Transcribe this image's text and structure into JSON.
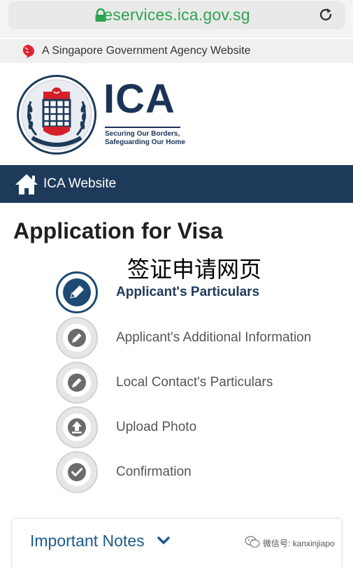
{
  "browser": {
    "url": "eservices.ica.gov.sg"
  },
  "gov_banner": {
    "text": "A Singapore Government Agency Website"
  },
  "logo": {
    "title": "ICA",
    "tagline_line1": "Securing Our Borders,",
    "tagline_line2": "Safeguarding Our Home",
    "crest_ring_text": "IMMIGRATION & CHECKPOINTS AUTHORITY SINGAPORE"
  },
  "nav": {
    "home_label": "ICA Website"
  },
  "page": {
    "title": "Application for Visa",
    "subtitle": "签证申请网页"
  },
  "steps": [
    {
      "label": "Applicant's Particulars",
      "state": "active",
      "icon": "pencil-icon"
    },
    {
      "label": "Applicant's Additional Information",
      "state": "inactive",
      "icon": "pencil-icon"
    },
    {
      "label": "Local Contact's Particulars",
      "state": "inactive",
      "icon": "pencil-icon"
    },
    {
      "label": "Upload Photo",
      "state": "inactive",
      "icon": "upload-icon"
    },
    {
      "label": "Confirmation",
      "state": "inactive",
      "icon": "check-icon"
    }
  ],
  "notes": {
    "title": "Important Notes"
  },
  "watermark": {
    "text": "微信号: kanxinjiapo"
  },
  "colors": {
    "url_green": "#2ea44f",
    "navy": "#1e3a5b",
    "notes_blue": "#1e5a8b",
    "crest_red": "#d4202a"
  }
}
